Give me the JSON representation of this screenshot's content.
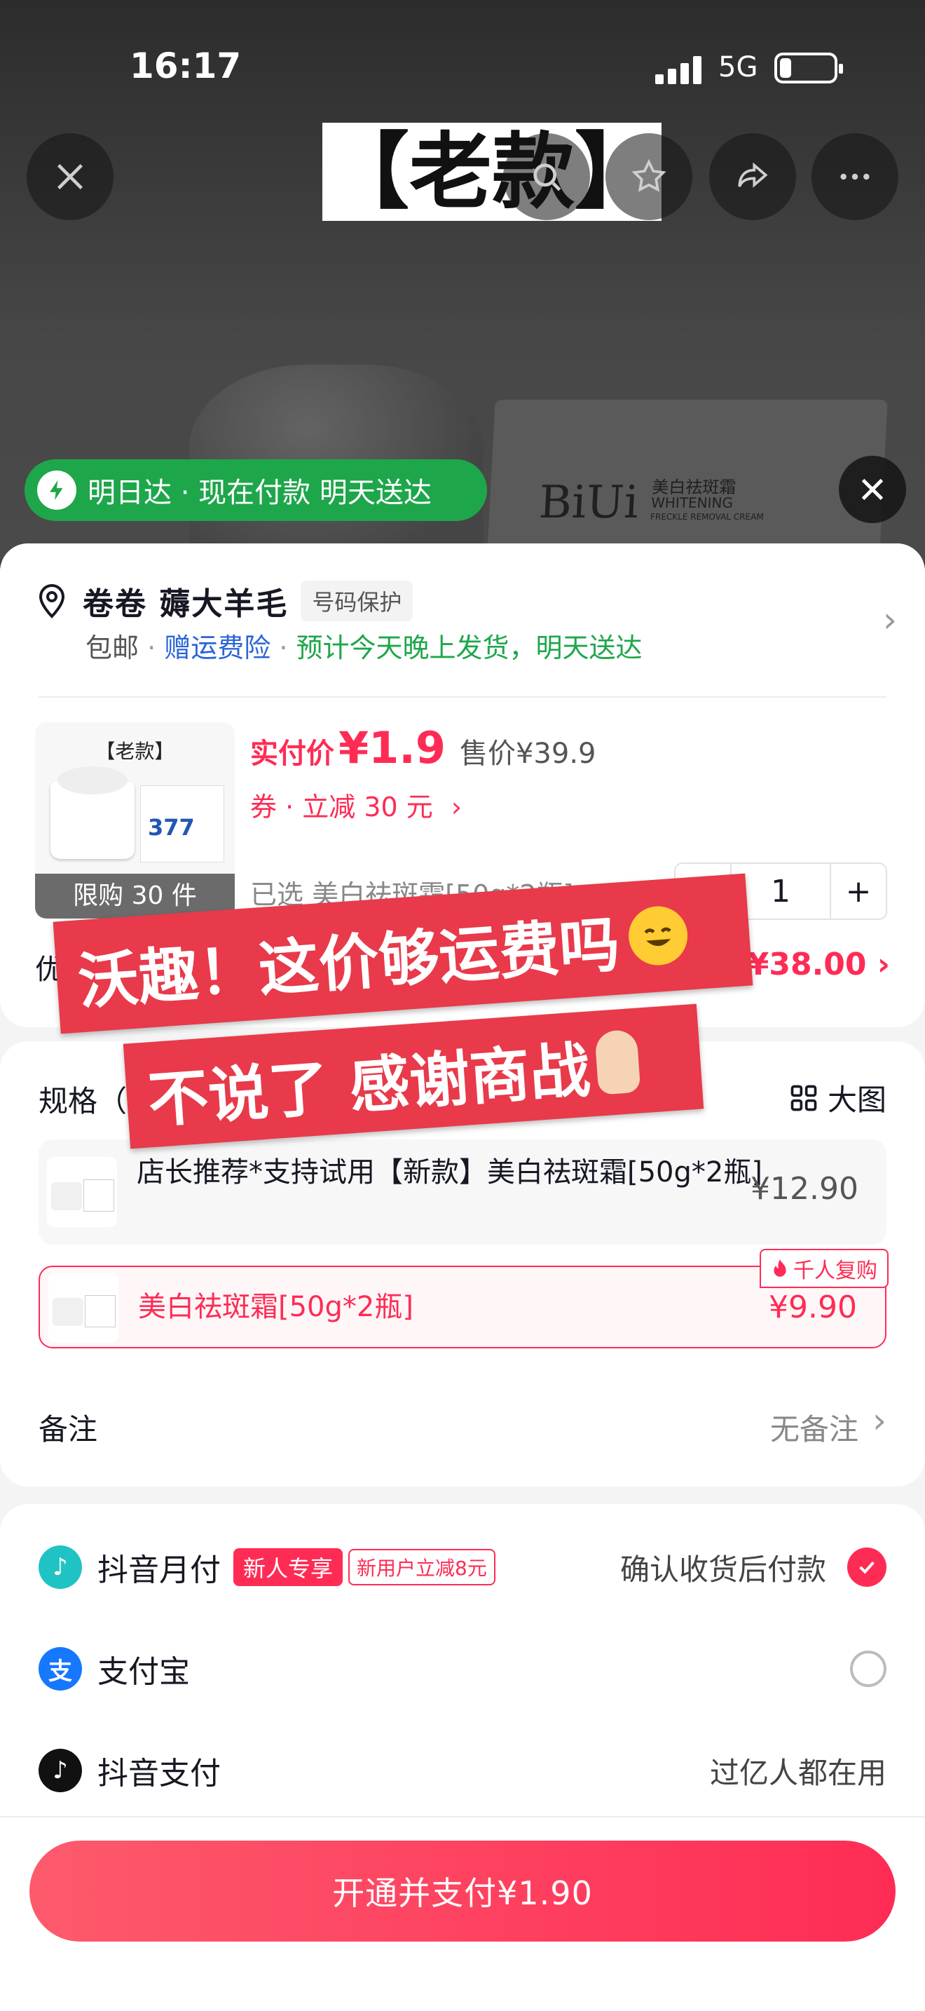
{
  "status": {
    "time": "16:17",
    "network": "5G"
  },
  "background": {
    "top_label": "【老款】",
    "brand": "BiUi",
    "box_cn": "美白祛斑霜",
    "box_en": "WHITENING",
    "box_en2": "FRECKLE REMOVAL CREAM",
    "delivery_pill": "明日达 · 现在付款 明天送达"
  },
  "address": {
    "name": "卷卷 薅大羊毛",
    "number_protect": "号码保护",
    "free_shipping": "包邮",
    "insurance": "赠运费险",
    "estimate": "预计今天晚上发货，明天送达"
  },
  "product": {
    "tag": "【老款】",
    "img_num": "377",
    "limit": "限购 30 件",
    "pay_label": "实付价",
    "pay_price": "¥1.9",
    "sale_label": "售价¥39.9",
    "coupon": "券 · 立减 30 元",
    "selected": "已选 美白祛斑霜[50g*2瓶]",
    "qty": "1",
    "minus": "−",
    "plus": "+",
    "discount_label": "优",
    "discount_value": "-¥38.00"
  },
  "spec": {
    "title": "规格（",
    "big_image": "大图",
    "options": [
      {
        "label": "店长推荐*支持试用【新款】美白祛斑霜[50g*2瓶]",
        "price": "¥12.90"
      },
      {
        "label": "美白祛斑霜[50g*2瓶]",
        "price": "¥9.90",
        "badge": "千人复购"
      }
    ],
    "note_label": "备注",
    "note_value": "无备注"
  },
  "payment": {
    "methods": [
      {
        "name": "抖音月付",
        "badge": "新人专享",
        "badge2": "新用户立减8元",
        "right": "确认收货后付款",
        "selected": true
      },
      {
        "name": "支付宝",
        "selected": false
      },
      {
        "name": "抖音支付",
        "right": "过亿人都在用"
      }
    ],
    "button": "开通并支付¥1.90"
  },
  "overlay": {
    "line1": "沃趣！这价够运费吗",
    "line2": "不说了 感谢商战"
  },
  "colors": {
    "accent": "#fe2c55",
    "green": "#1ea64b",
    "blue": "#2a64d8"
  }
}
